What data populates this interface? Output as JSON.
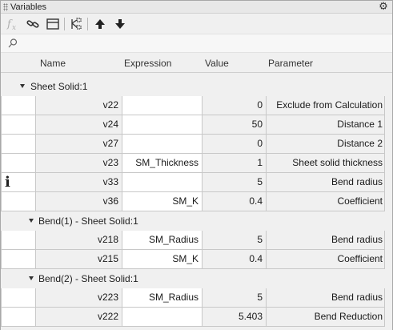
{
  "panel": {
    "title": "Variables"
  },
  "toolbar": {
    "icons": [
      "fx-icon",
      "link-icon",
      "window-icon",
      "tree-icon",
      "arrow-up-icon",
      "arrow-down-icon"
    ]
  },
  "search": {
    "value": "",
    "placeholder": ""
  },
  "columns": {
    "name": "Name",
    "expression": "Expression",
    "value": "Value",
    "parameter": "Parameter"
  },
  "groups": [
    {
      "label": "Sheet Solid:1",
      "rows": [
        {
          "name": "v22",
          "expression": "",
          "value": "0",
          "parameter": "Exclude from Calculation",
          "status": ""
        },
        {
          "name": "v24",
          "expression": "",
          "value": "50",
          "parameter": "Distance 1",
          "status": ""
        },
        {
          "name": "v27",
          "expression": "",
          "value": "0",
          "parameter": "Distance 2",
          "status": ""
        },
        {
          "name": "v23",
          "expression": "SM_Thickness",
          "value": "1",
          "parameter": "Sheet solid thickness",
          "status": ""
        },
        {
          "name": "v33",
          "expression": "",
          "value": "5",
          "parameter": "Bend radius",
          "status": "i"
        },
        {
          "name": "v36",
          "expression": "SM_K",
          "value": "0.4",
          "parameter": "Coefficient",
          "status": ""
        }
      ]
    },
    {
      "label": "Bend(1) - Sheet Solid:1",
      "rows": [
        {
          "name": "v218",
          "expression": "SM_Radius",
          "value": "5",
          "parameter": "Bend radius",
          "status": ""
        },
        {
          "name": "v215",
          "expression": "SM_K",
          "value": "0.4",
          "parameter": "Coefficient",
          "status": ""
        }
      ]
    },
    {
      "label": "Bend(2) - Sheet Solid:1",
      "rows": [
        {
          "name": "v223",
          "expression": "SM_Radius",
          "value": "5",
          "parameter": "Bend radius",
          "status": ""
        },
        {
          "name": "v222",
          "expression": "",
          "value": "5.403",
          "parameter": "Bend Reduction",
          "status": ""
        }
      ]
    }
  ]
}
